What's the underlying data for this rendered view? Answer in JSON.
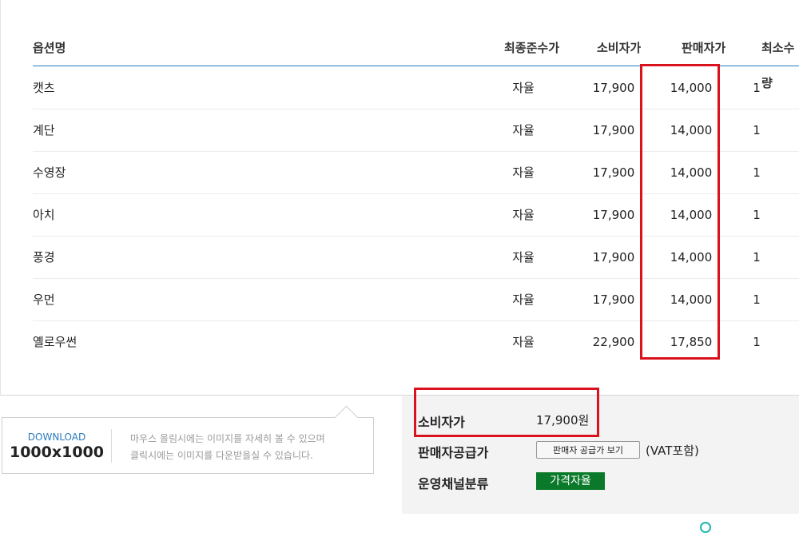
{
  "table": {
    "headers": {
      "name": "옵션명",
      "final_price": "최종준수가",
      "consumer_price": "소비자가",
      "sale_price": "판매자가",
      "min_qty": "최소수량"
    },
    "rows": [
      {
        "name": "캣츠",
        "final_price": "자율",
        "consumer_price": "17,900",
        "sale_price": "14,000",
        "min_qty": "1"
      },
      {
        "name": "계단",
        "final_price": "자율",
        "consumer_price": "17,900",
        "sale_price": "14,000",
        "min_qty": "1"
      },
      {
        "name": "수영장",
        "final_price": "자율",
        "consumer_price": "17,900",
        "sale_price": "14,000",
        "min_qty": "1"
      },
      {
        "name": "아치",
        "final_price": "자율",
        "consumer_price": "17,900",
        "sale_price": "14,000",
        "min_qty": "1"
      },
      {
        "name": "풍경",
        "final_price": "자율",
        "consumer_price": "17,900",
        "sale_price": "14,000",
        "min_qty": "1"
      },
      {
        "name": "우먼",
        "final_price": "자율",
        "consumer_price": "17,900",
        "sale_price": "14,000",
        "min_qty": "1"
      },
      {
        "name": "옐로우썬",
        "final_price": "자율",
        "consumer_price": "22,900",
        "sale_price": "17,850",
        "min_qty": "1"
      }
    ]
  },
  "download": {
    "label": "DOWNLOAD",
    "size": "1000x1000",
    "help_line1": "마우스 올림시에는 이미지를 자세히 볼 수 있으며",
    "help_line2": "클릭시에는 이미지를 다운받을실 수 있습니다."
  },
  "info": {
    "consumer_label": "소비자가",
    "consumer_value": "17,900원",
    "supply_label": "판매자공급가",
    "supply_button": "판매자 공급가 보기",
    "vat_note": "(VAT포함)",
    "channel_label": "운영채널분류",
    "channel_badge": "가격자율"
  },
  "colors": {
    "highlight": "#d9121d",
    "header_line": "#2a7cbf",
    "badge": "#0a7a2a",
    "download_label": "#2a7cbf"
  }
}
